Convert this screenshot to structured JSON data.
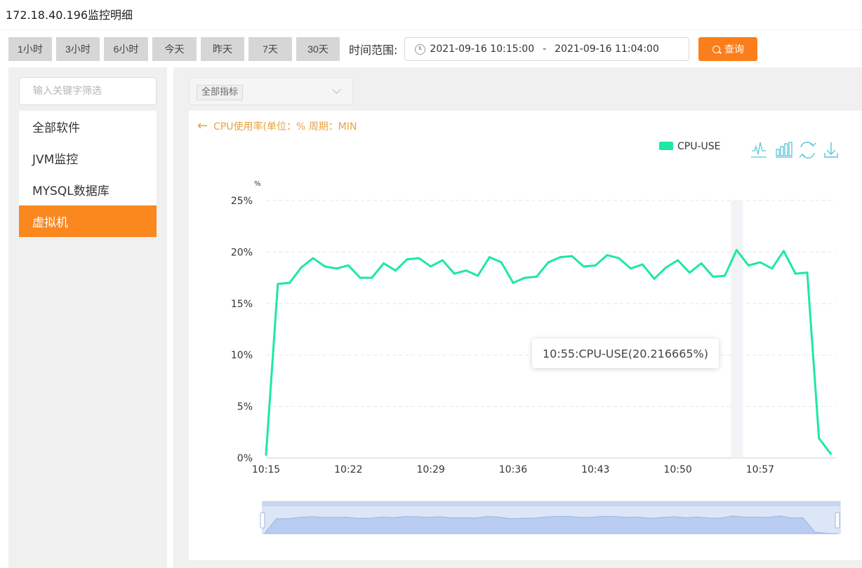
{
  "page": {
    "title": "172.18.40.196监控明细"
  },
  "toolbar": {
    "quick_ranges": [
      "1小时",
      "3小时",
      "6小时",
      "今天",
      "昨天",
      "7天",
      "30天"
    ],
    "range_label": "时间范围:",
    "start_time": "2021-09-16 10:15:00",
    "end_time": "2021-09-16 11:04:00",
    "separator": "-",
    "query_label": "查询"
  },
  "sidebar": {
    "filter_placeholder": "输入关键字筛选",
    "items": [
      "全部软件",
      "JVM监控",
      "MYSQL数据库",
      "虚拟机"
    ],
    "active_index": 3
  },
  "main": {
    "metric_select": "全部指标",
    "chart_header": "CPU使用率(单位：% 周期：MIN",
    "tooltip": "10:55:CPU-USE(20.216665%)"
  },
  "colors": {
    "accent": "#fb7e1a",
    "series": "#1de9a0",
    "active_menu": "#fb871f",
    "toolbox_icon": "#5cc4d9"
  },
  "icons": [
    "clock-icon",
    "search-icon",
    "back-arrow-icon",
    "line-chart-icon",
    "bar-chart-icon",
    "refresh-icon",
    "download-icon",
    "chevron-down-icon"
  ],
  "chart_data": {
    "type": "line",
    "ylabel": "%",
    "x": [
      "10:15",
      "10:16",
      "10:17",
      "10:18",
      "10:19",
      "10:20",
      "10:21",
      "10:22",
      "10:23",
      "10:24",
      "10:25",
      "10:26",
      "10:27",
      "10:28",
      "10:29",
      "10:30",
      "10:31",
      "10:32",
      "10:33",
      "10:34",
      "10:35",
      "10:36",
      "10:37",
      "10:38",
      "10:39",
      "10:40",
      "10:41",
      "10:42",
      "10:43",
      "10:44",
      "10:45",
      "10:46",
      "10:47",
      "10:48",
      "10:49",
      "10:50",
      "10:51",
      "10:52",
      "10:53",
      "10:54",
      "10:55",
      "10:56",
      "10:57",
      "10:58",
      "10:59",
      "11:00",
      "11:01",
      "11:02",
      "11:03",
      "11:04"
    ],
    "x_ticks": [
      "10:15",
      "10:22",
      "10:29",
      "10:36",
      "10:43",
      "10:50",
      "10:57"
    ],
    "y_ticks": [
      "0%",
      "5%",
      "10%",
      "15%",
      "20%",
      "25%"
    ],
    "ylim": [
      0,
      25
    ],
    "series": [
      {
        "name": "CPU-USE",
        "values": [
          0.3,
          16.9,
          17.0,
          18.5,
          19.4,
          18.6,
          18.4,
          18.7,
          17.5,
          17.5,
          18.9,
          18.2,
          19.3,
          19.4,
          18.6,
          19.2,
          17.9,
          18.2,
          17.7,
          19.5,
          19.0,
          17.0,
          17.5,
          17.6,
          19.0,
          19.5,
          19.6,
          18.6,
          18.7,
          19.7,
          19.4,
          18.4,
          18.8,
          17.4,
          18.5,
          19.2,
          18.0,
          18.9,
          17.6,
          17.7,
          20.2,
          18.7,
          19.0,
          18.4,
          20.1,
          17.9,
          18.0,
          1.9,
          0.4
        ]
      }
    ],
    "legend": "top-right",
    "grid": true,
    "highlight_x": "10:55"
  }
}
